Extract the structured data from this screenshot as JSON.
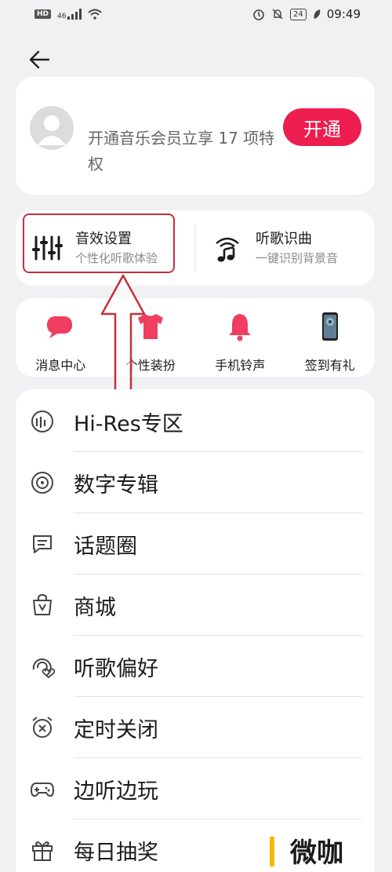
{
  "status_bar": {
    "hd": "HD",
    "network": "46",
    "battery": "24",
    "time": "09:49"
  },
  "member": {
    "text": "开通音乐会员立享 17 项特权",
    "button_label": "开通"
  },
  "features": [
    {
      "title": "音效设置",
      "subtitle": "个性化听歌体验",
      "icon": "equalizer-icon"
    },
    {
      "title": "听歌识曲",
      "subtitle": "一键识别背景音",
      "icon": "music-recognition-icon"
    }
  ],
  "quick_actions": [
    {
      "label": "消息中心",
      "icon": "message-center-icon"
    },
    {
      "label": "个性装扮",
      "icon": "shirt-icon"
    },
    {
      "label": "手机铃声",
      "icon": "bell-icon"
    },
    {
      "label": "签到有礼",
      "icon": "phone-gift-icon"
    }
  ],
  "menu": [
    {
      "label": "Hi-Res专区",
      "icon": "hi-res-icon"
    },
    {
      "label": "数字专辑",
      "icon": "disc-icon"
    },
    {
      "label": "话题圈",
      "icon": "chat-icon"
    },
    {
      "label": "商城",
      "icon": "shopping-bag-icon"
    },
    {
      "label": "听歌偏好",
      "icon": "preference-icon"
    },
    {
      "label": "定时关闭",
      "icon": "alarm-clock-icon"
    },
    {
      "label": "边听边玩",
      "icon": "gamepad-icon"
    },
    {
      "label": "每日抽奖",
      "icon": "gift-icon"
    }
  ],
  "watermark": "微咖",
  "colors": {
    "accent": "#ed1e4f",
    "annotation": "#c8303a",
    "background": "#f1f1f3"
  }
}
